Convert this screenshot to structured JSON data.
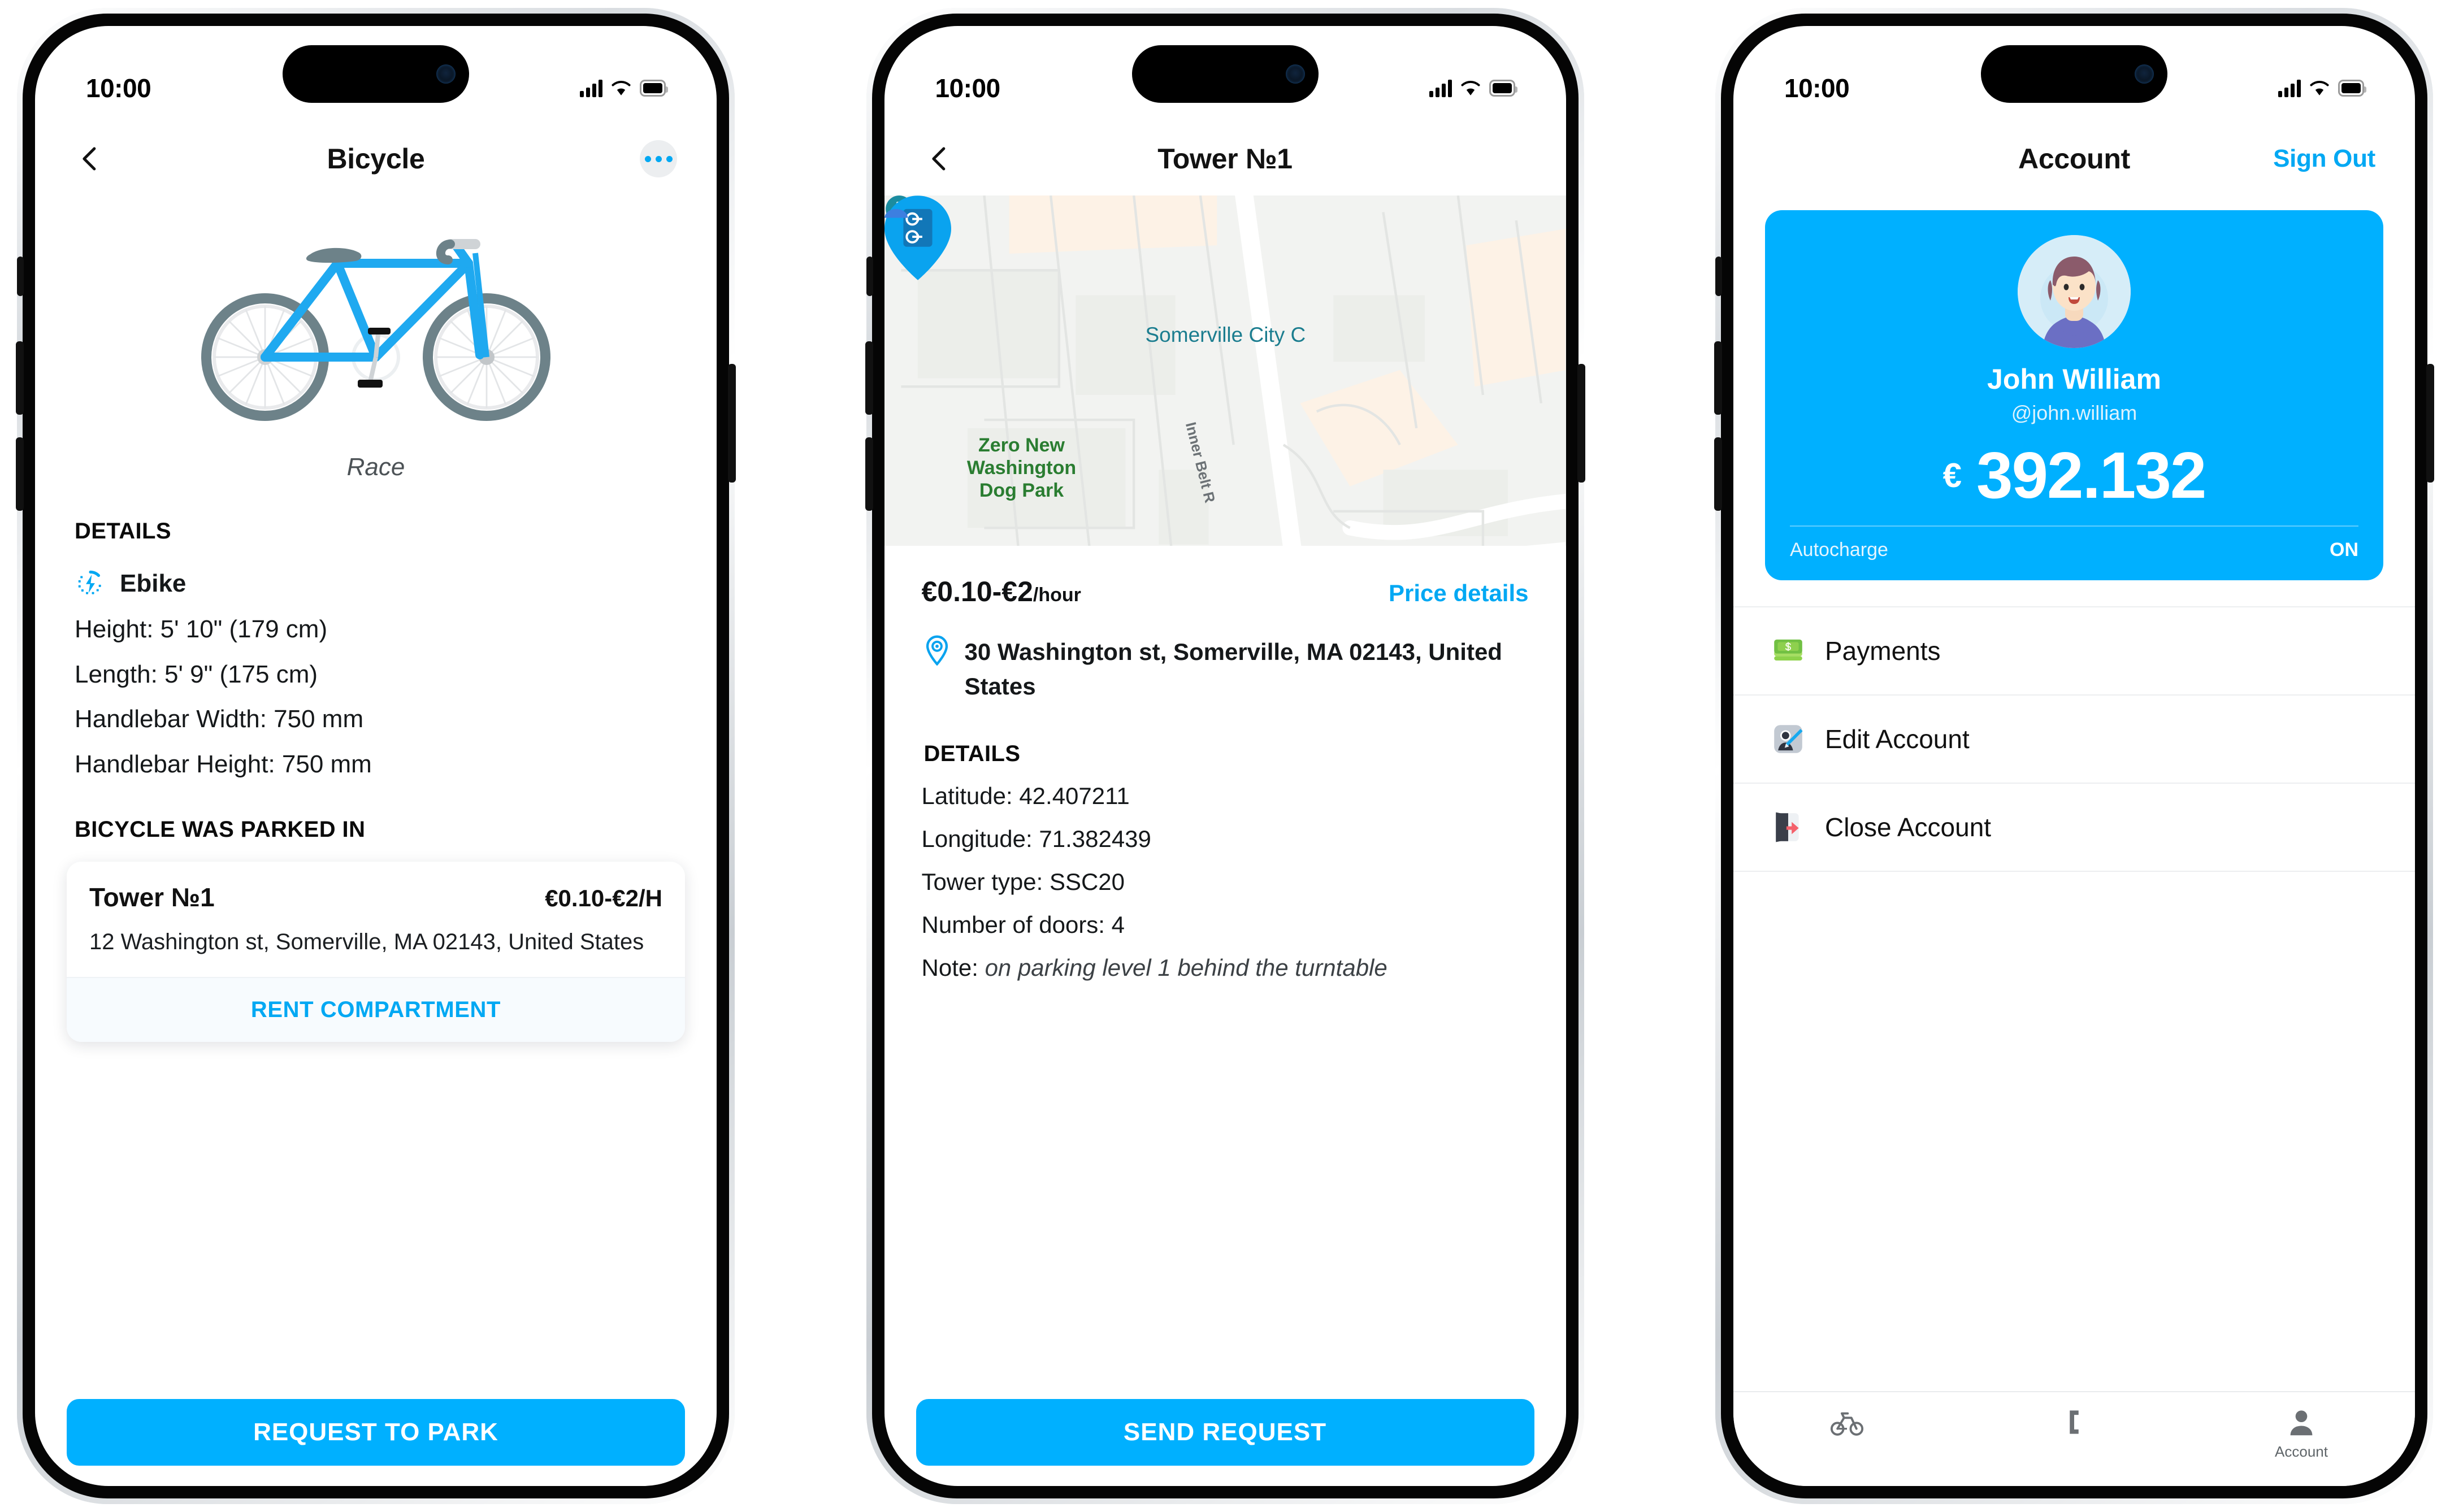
{
  "statusbar": {
    "time": "10:00"
  },
  "colors": {
    "accent": "#00b0ff",
    "link": "#00a8f3",
    "text": "#15181a",
    "card_blue": "#00b0ff",
    "map_green": "#2a7d31",
    "map_poi": "#1b7d8f"
  },
  "phone1": {
    "nav": {
      "back_icon": "chevron-left-icon",
      "title": "Bicycle",
      "more_icon": "more-dots-icon"
    },
    "illustration": {
      "name": "bicycle-illustration",
      "caption": "Race"
    },
    "details_heading": "DETAILS",
    "ebike": {
      "icon": "ebike-bolt-icon",
      "label": "Ebike"
    },
    "specs": [
      "Height: 5' 10\" (179 cm)",
      "Length: 5' 9\" (175 cm)",
      "Handlebar Width: 750 mm",
      "Handlebar Height: 750 mm"
    ],
    "parked_heading": "BICYCLE WAS PARKED IN",
    "park_card": {
      "name": "Tower №1",
      "price": "€0.10-€2/H",
      "address": "12 Washington st, Somerville, MA 02143, United States",
      "action": "RENT COMPARTMENT"
    },
    "cta": "REQUEST TO PARK"
  },
  "phone2": {
    "nav": {
      "back_icon": "chevron-left-icon",
      "title": "Tower №1"
    },
    "map": {
      "marker_icon": "bike-tower-pin-icon",
      "poi_pin_icon": "civic-building-pin-icon",
      "poi_label": "Somerville City C",
      "park_label": "Zero New Washington Dog Park",
      "road_label": "Inner Belt R",
      "edge_marker_icon": "map-marker-partial-icon"
    },
    "price": {
      "value": "€0.10-€2",
      "unit": "/hour",
      "link": "Price details"
    },
    "address": {
      "icon": "location-pin-icon",
      "text": "30 Washington st, Somerville, MA 02143, United States"
    },
    "details_heading": "DETAILS",
    "details": [
      {
        "label": "Latitude: ",
        "value": "42.407211",
        "italic": false
      },
      {
        "label": "Longitude: ",
        "value": "71.382439",
        "italic": false
      },
      {
        "label": "Tower type: ",
        "value": "SSC20",
        "italic": false
      },
      {
        "label": "Number of doors: ",
        "value": "4",
        "italic": false
      },
      {
        "label": "Note:  ",
        "value": "on parking level 1 behind the turntable",
        "italic": true
      }
    ],
    "cta": "SEND REQUEST"
  },
  "phone3": {
    "nav": {
      "title": "Account",
      "signout": "Sign Out"
    },
    "card": {
      "avatar_icon": "user-avatar",
      "name": "John William",
      "handle": "@john.william",
      "currency": "€",
      "balance": "392.132",
      "autocharge_label": "Autocharge",
      "autocharge_value": "ON"
    },
    "menu": [
      {
        "icon": "money-icon",
        "label": "Payments"
      },
      {
        "icon": "edit-account-icon",
        "label": "Edit Account"
      },
      {
        "icon": "close-account-icon",
        "label": "Close Account"
      }
    ],
    "tabs": [
      {
        "icon": "bicycle-icon",
        "label": ""
      },
      {
        "icon": "tower-icon",
        "label": ""
      },
      {
        "icon": "account-person-icon",
        "label": "Account"
      }
    ]
  }
}
